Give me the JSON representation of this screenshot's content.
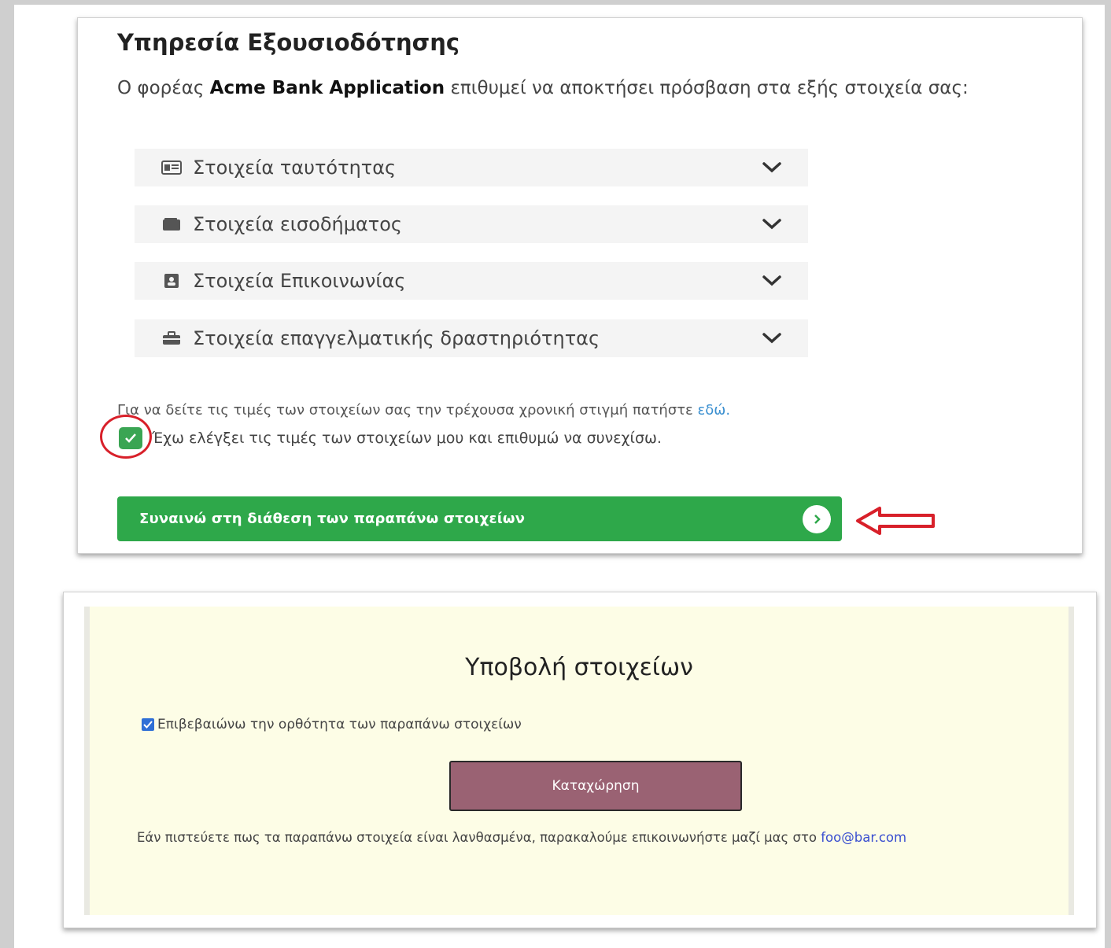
{
  "auth": {
    "title": "Υπηρεσία Εξουσιοδότησης",
    "intro_prefix": "Ο φορέας",
    "intro_org": "Acme Bank Application",
    "intro_suffix": "επιθυμεί να αποκτήσει πρόσβαση στα εξής στοιχεία σας:",
    "sections": [
      {
        "label": "Στοιχεία ταυτότητας",
        "icon": "id-card-icon"
      },
      {
        "label": "Στοιχεία εισοδήματος",
        "icon": "wallet-icon"
      },
      {
        "label": "Στοιχεία Επικοινωνίας",
        "icon": "contact-book-icon"
      },
      {
        "label": "Στοιχεία επαγγελματικής δραστηριότητας",
        "icon": "briefcase-icon"
      }
    ],
    "hint_text": "Για να δείτε τις τιμές των στοιχείων σας την τρέχουσα χρονική στιγμή πατήστε",
    "hint_link": "εδώ.",
    "check_label": "Έχω ελέγξει τις τιμές των στοιχείων μου και επιθυμώ να συνεχίσω.",
    "consent_button": "Συναινώ στη διάθεση των παραπάνω στοιχείων"
  },
  "submit": {
    "title": "Υποβολή στοιχείων",
    "check_label": "Επιβεβαιώνω την ορθότητα των παραπάνω στοιχείων",
    "button": "Καταχώρηση",
    "note": "Εάν πιστεύετε πως τα παραπάνω στοιχεία είναι λανθασμένα, παρακαλούμε επικοινωνήστε μαζί μας στο",
    "email": "foo@bar.com"
  },
  "colors": {
    "consent_green": "#2ea84a",
    "annotation_red": "#d8202a",
    "submit_button": "#9a6273",
    "submit_background": "#fdfde6"
  }
}
